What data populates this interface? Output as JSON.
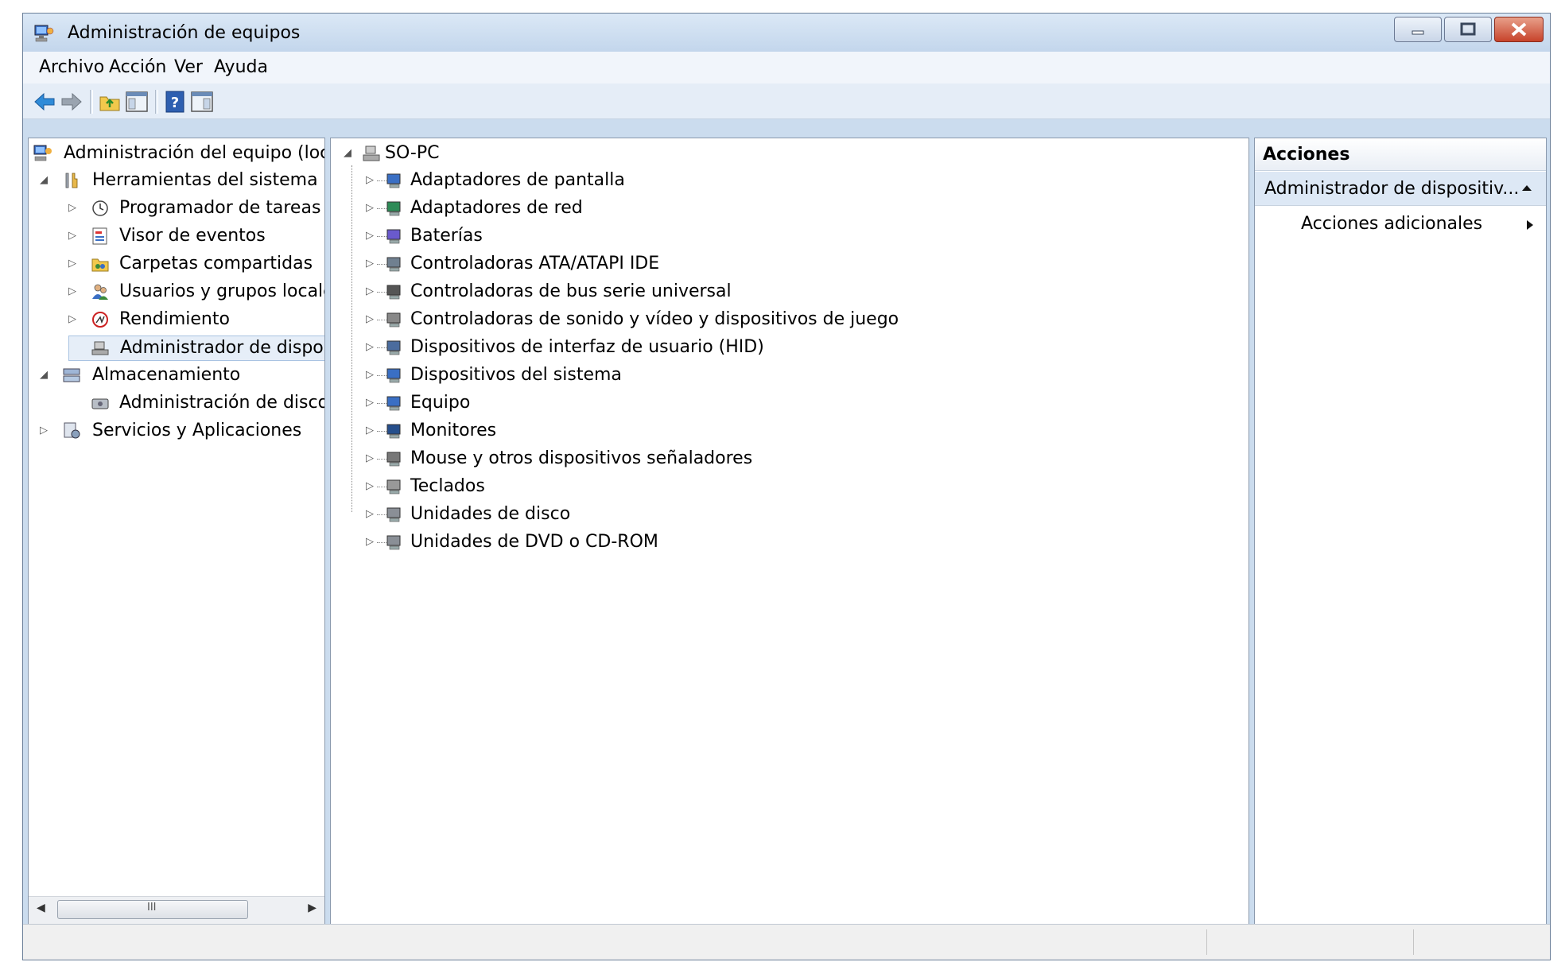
{
  "window": {
    "title": "Administración de equipos"
  },
  "menu": [
    "Archivo",
    "Acción",
    "Ver",
    "Ayuda"
  ],
  "left_tree": {
    "root": "Administración del equipo (loc",
    "system_tools": "Herramientas del sistema",
    "items": [
      "Programador de tareas",
      "Visor de eventos",
      "Carpetas compartidas",
      "Usuarios y grupos locale",
      "Rendimiento",
      "Administrador de dispo"
    ],
    "storage": "Almacenamiento",
    "disk_mgmt": "Administración de disco",
    "services": "Servicios y Aplicaciones"
  },
  "device_tree": {
    "root": "SO-PC",
    "items": [
      "Adaptadores de pantalla",
      "Adaptadores de red",
      "Baterías",
      "Controladoras ATA/ATAPI IDE",
      "Controladoras de bus serie universal",
      "Controladoras de sonido y vídeo y dispositivos de juego",
      "Dispositivos de interfaz de usuario (HID)",
      "Dispositivos del sistema",
      "Equipo",
      "Monitores",
      "Mouse y otros dispositivos señaladores",
      "Teclados",
      "Unidades de disco",
      "Unidades de DVD o CD-ROM"
    ]
  },
  "actions": {
    "header": "Acciones",
    "section": "Administrador de dispositiv...",
    "more": "Acciones adicionales"
  },
  "scrollbar": {
    "grip": "III"
  }
}
